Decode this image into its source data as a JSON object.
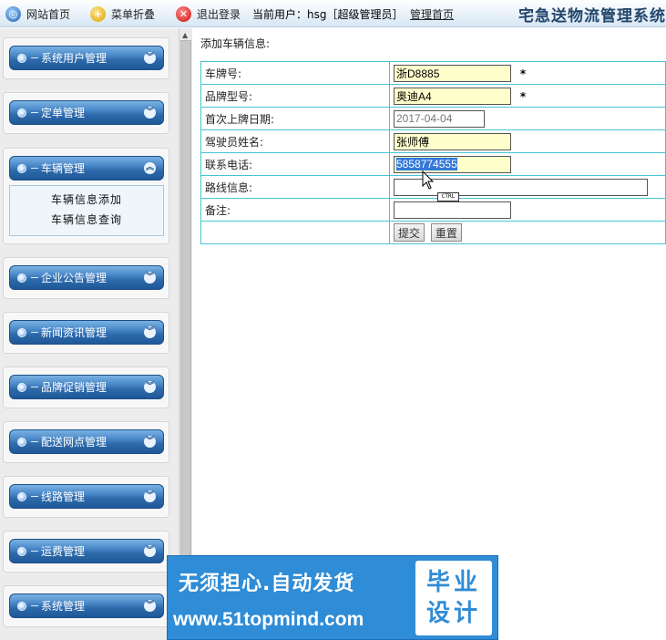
{
  "topbar": {
    "home": "网站首页",
    "collapse": "菜单折叠",
    "logout": "退出登录",
    "current_user": "当前用户：hsg［超级管理员］",
    "admin_home": "管理首页",
    "system_title": "宅急送物流管理系统"
  },
  "sidebar": {
    "groups": [
      {
        "label": "系统用户管理"
      },
      {
        "label": "定单管理"
      },
      {
        "label": "车辆管理",
        "expanded": true,
        "items": [
          "车辆信息添加",
          "车辆信息查询"
        ]
      },
      {
        "label": "企业公告管理"
      },
      {
        "label": "新闻资讯管理"
      },
      {
        "label": "品牌促销管理"
      },
      {
        "label": "配送网点管理"
      },
      {
        "label": "线路管理"
      },
      {
        "label": "运费管理"
      },
      {
        "label": "系统管理"
      }
    ]
  },
  "form": {
    "title": "添加车辆信息:",
    "rows": [
      {
        "label": "车牌号:",
        "value": "浙D8885",
        "required": true
      },
      {
        "label": "品牌型号:",
        "value": "奥迪A4",
        "required": true
      },
      {
        "label": "首次上牌日期:",
        "value": "2017-04-04"
      },
      {
        "label": "驾驶员姓名:",
        "value": "张师傅"
      },
      {
        "label": "联系电话:",
        "value": "5858774555"
      },
      {
        "label": "路线信息:",
        "value": ""
      },
      {
        "label": "备注:",
        "value": ""
      }
    ],
    "required_mark": "*",
    "submit": "提交",
    "reset": "重置"
  },
  "overlay": {
    "ctrl_badge": "CTRL"
  },
  "watermark": {
    "line1": "无须担心.自动发货",
    "line2": "www.51topmind.com",
    "badge_line1": "毕业",
    "badge_line2": "设计"
  },
  "colors": {
    "menu_blue": "#2d6aac",
    "table_border": "#48c3d6",
    "input_highlight": "#ffffcc",
    "selection": "#3478d8",
    "watermark_blue": "#2f8cd6"
  }
}
